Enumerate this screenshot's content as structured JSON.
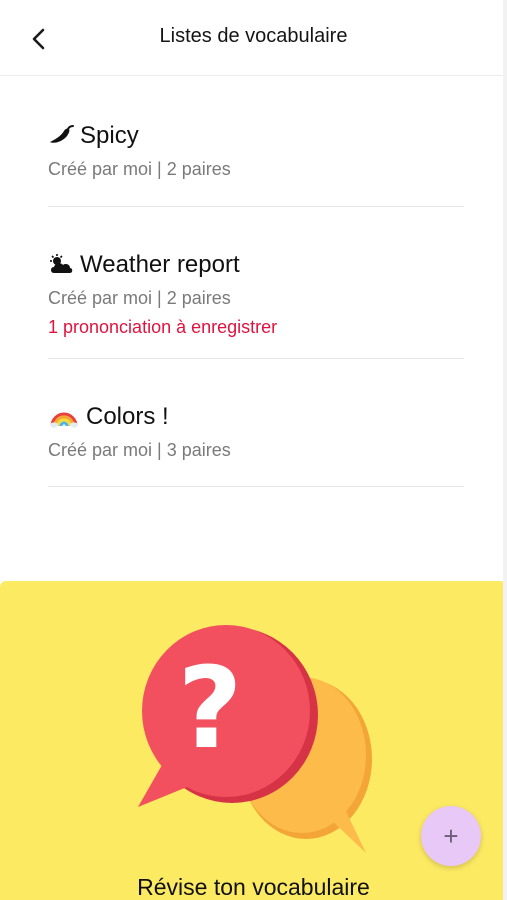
{
  "header": {
    "title": "Listes de vocabulaire",
    "back_icon": "chevron-left-icon"
  },
  "lists": [
    {
      "icon": "chili-pepper-icon",
      "title": "Spicy",
      "subtitle": "Créé par moi | 2 paires",
      "warning": ""
    },
    {
      "icon": "cloud-sun-icon",
      "title": "Weather report",
      "subtitle": "Créé par moi | 2 paires",
      "warning": "1 prononciation à enregistrer"
    },
    {
      "icon": "rainbow-icon",
      "title": "Colors !",
      "subtitle": "Créé par moi | 3 paires",
      "warning": ""
    }
  ],
  "promo": {
    "title": "Révise ton vocabulaire",
    "background": "#fdea63",
    "bubble_front_color": "#f1475a",
    "bubble_back_color": "#fdb947",
    "mark": "?"
  },
  "fab": {
    "label": "+",
    "color": "#e8c8f6"
  },
  "colors": {
    "warning": "#e0133f",
    "subtitle": "#7a7a7a"
  }
}
